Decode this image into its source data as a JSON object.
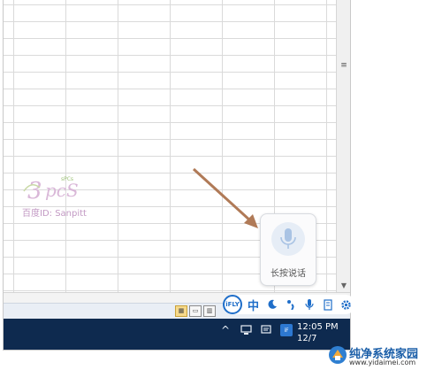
{
  "colors": {
    "taskbar": "#0e2a4f",
    "ime_accent": "#1f6ec9",
    "arrow": "#b07a57"
  },
  "watermark": {
    "id_text": "百度ID: Sanpitt",
    "logo_icon": "3PCS-logo"
  },
  "voice_popup": {
    "label": "长按说话",
    "icon": "microphone-icon"
  },
  "ime_toolbar": {
    "logo": "iFLY",
    "lang": "中",
    "items": [
      "moon-icon",
      "punctuation-icon",
      "microphone-icon",
      "keyboard-icon",
      "gear-icon"
    ]
  },
  "statusbar": {
    "view_icons": [
      "normal-view-icon",
      "page-layout-icon",
      "page-break-icon"
    ]
  },
  "taskbar": {
    "tray_chevron": "^",
    "clock_time": "12:05 PM",
    "clock_date": "12/7"
  },
  "brand": {
    "name": "纯净系统家园",
    "url": "www.yidaimei.com"
  }
}
